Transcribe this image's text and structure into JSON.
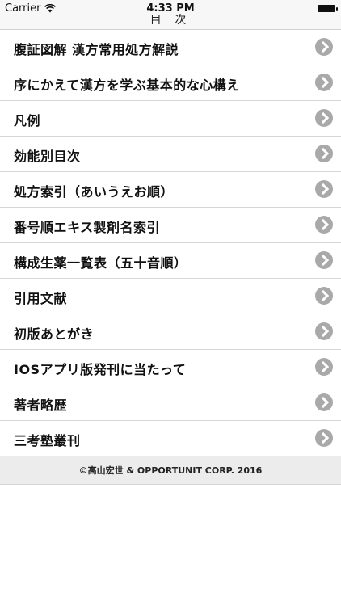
{
  "status_bar": {
    "carrier": "Carrier",
    "time": "4:33 PM"
  },
  "nav": {
    "title": "目 次"
  },
  "menu": {
    "items": [
      {
        "label": "腹証図解 漢方常用処方解説"
      },
      {
        "label": "序にかえて漢方を学ぶ基本的な心構え"
      },
      {
        "label": "凡例"
      },
      {
        "label": "効能別目次"
      },
      {
        "label": "処方索引（あいうえお順）"
      },
      {
        "label": "番号順エキス製剤名索引"
      },
      {
        "label": "構成生薬一覧表（五十音順）"
      },
      {
        "label": "引用文献"
      },
      {
        "label": "初版あとがき"
      },
      {
        "label": "IOSアプリ版発刊に当たって"
      },
      {
        "label": "著者略歴"
      },
      {
        "label": "三考塾叢刊"
      }
    ]
  },
  "footer": {
    "copyright": "©高山宏世 & OPPORTUNIT CORP. 2016"
  },
  "icons": {
    "wifi": "wifi-icon",
    "battery": "battery-icon",
    "row_chevron": "chevron-right-circle-icon"
  },
  "colors": {
    "bar_background": "#f7f7f7",
    "chevron": "#a9a9a9",
    "footer_background": "#ececec"
  }
}
